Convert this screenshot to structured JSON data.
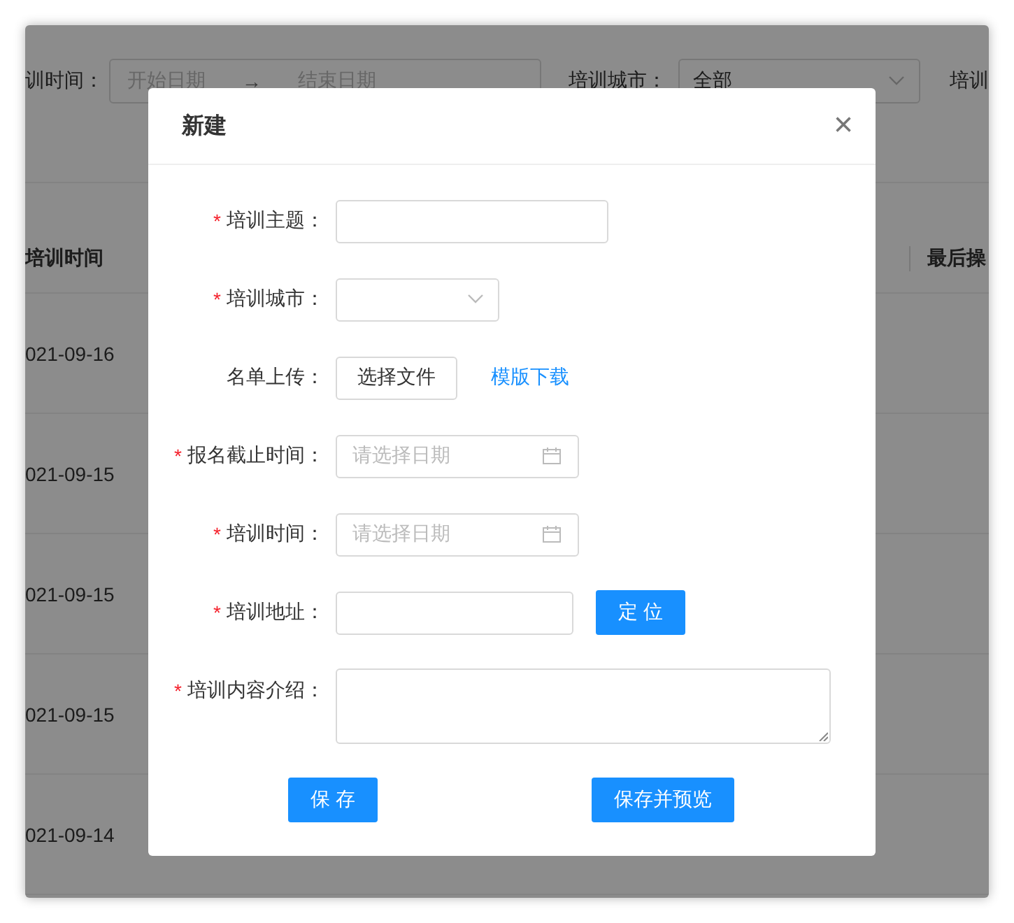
{
  "filters": {
    "date_label": "训时间：",
    "start_placeholder": "开始日期",
    "separator": "→",
    "end_placeholder": "结束日期",
    "city_label": "培训城市：",
    "city_value": "全部",
    "status_label": "培训"
  },
  "table": {
    "columns": [
      "培训时间",
      "最后操"
    ],
    "rows": [
      "021-09-16",
      "021-09-15",
      "021-09-15",
      "021-09-15",
      "021-09-14"
    ]
  },
  "dialog": {
    "title": "新建",
    "close": "×",
    "fields": [
      {
        "kind": "text",
        "label": "培训主题：",
        "required_mark": "*"
      },
      {
        "kind": "select",
        "label": "培训城市：",
        "required_mark": "*"
      },
      {
        "kind": "upload",
        "label": "名单上传：",
        "button": "选择文件",
        "link": "模版下载"
      },
      {
        "kind": "date",
        "label": "报名截止时间：",
        "required_mark": "*",
        "placeholder": "请选择日期"
      },
      {
        "kind": "date",
        "label": "培训时间：",
        "required_mark": "*",
        "placeholder": "请选择日期"
      },
      {
        "kind": "locate",
        "label": "培训地址：",
        "required_mark": "*",
        "button": "定 位"
      },
      {
        "kind": "textarea",
        "label": "培训内容介绍：",
        "required_mark": "*"
      }
    ],
    "buttons": [
      "保 存",
      "保存并预览"
    ]
  }
}
